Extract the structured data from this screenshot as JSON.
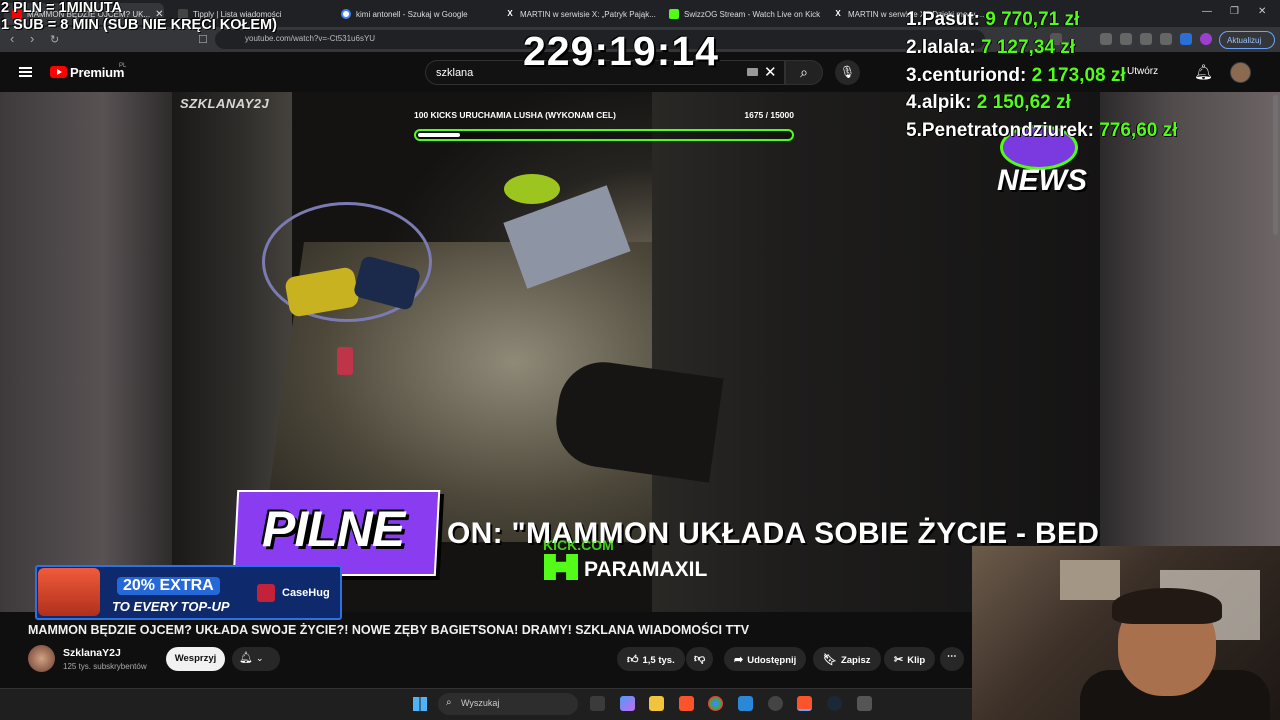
{
  "browser": {
    "tabs": [
      {
        "label": "MAMMON BĘDZIE OJCEM? UK...",
        "icon": "youtube-icon",
        "color": "#ff0000",
        "active": true
      },
      {
        "label": "Tipply | Lista wiadomości",
        "icon": "tipply-icon",
        "color": "#888888"
      },
      {
        "label": "kimi antonell - Szukaj w Google",
        "icon": "google-icon",
        "color": "#4285f4"
      },
      {
        "label": "MARTIN w serwisie X: „Patryk Pająk...",
        "icon": "x-icon",
        "color": "#ffffff"
      },
      {
        "label": "SwizzOG Stream - Watch Live on Kick",
        "icon": "kick-icon",
        "color": "#53fc18"
      },
      {
        "label": "MARTIN w serwisie X: „Dzięki mocy ...",
        "icon": "x-icon",
        "color": "#ffffff"
      }
    ],
    "url": "youtube.com/watch?v=-Ct531u6sYU",
    "update_button": "Aktualizuj"
  },
  "youtube": {
    "logo_text": "Premium",
    "region": "PL",
    "search_value": "szklana",
    "create_label": "Utwórz"
  },
  "overlay": {
    "info_line1": "2 PLN = 1MINUTA",
    "info_line2": "1 SUB = 8 MIN (SUB NIE KRĘCI KOŁEM)",
    "timer": "229:19:14",
    "leaderboard": [
      {
        "rank": "1.",
        "name": "Pasut:",
        "amount": "9 770,71 zł"
      },
      {
        "rank": "2.",
        "name": "lalala:",
        "amount": "7 127,34 zł"
      },
      {
        "rank": "3.",
        "name": "centuriond:",
        "amount": "2 173,08 zł"
      },
      {
        "rank": "4.",
        "name": "alpik:",
        "amount": "2 150,62 zł"
      },
      {
        "rank": "5.",
        "name": "Penetratondziurek:",
        "amount": "776,60 zł"
      }
    ],
    "news_label": "NEWS",
    "channel_watermark": "SZKLANAY2J",
    "goal_label": "100 KICKS URUCHAMIA LUSHA (WYKONAM CEL)",
    "goal_value": "1675 / 15000",
    "goal_fraction": 0.112,
    "pilne_label": "PILNE",
    "ticker_text": "ON: \"MAMMON UKŁADA SOBIE ŻYCIE - BEDZIE OJC",
    "kick_small": "KICK.COM",
    "kick_name": "PARAMAXIL",
    "promo_line1": "20% EXTRA",
    "promo_line2": "TO EVERY TOP-UP",
    "promo_brand": "CaseHug"
  },
  "video": {
    "title": "MAMMON BĘDZIE OJCEM? UKŁADA SWOJE ŻYCIE?! NOWE ZĘBY BAGIETSONA! DRAMY! SZKLANA WIADOMOŚCI TTV",
    "channel": "SzklanaY2J",
    "subscribers": "125 tys. subskrybentów",
    "support_label": "Wesprzyj",
    "likes": "1,5 tys.",
    "share_label": "Udostępnij",
    "save_label": "Zapisz",
    "clip_label": "Klip"
  },
  "taskbar": {
    "search_placeholder": "Wyszukaj"
  }
}
